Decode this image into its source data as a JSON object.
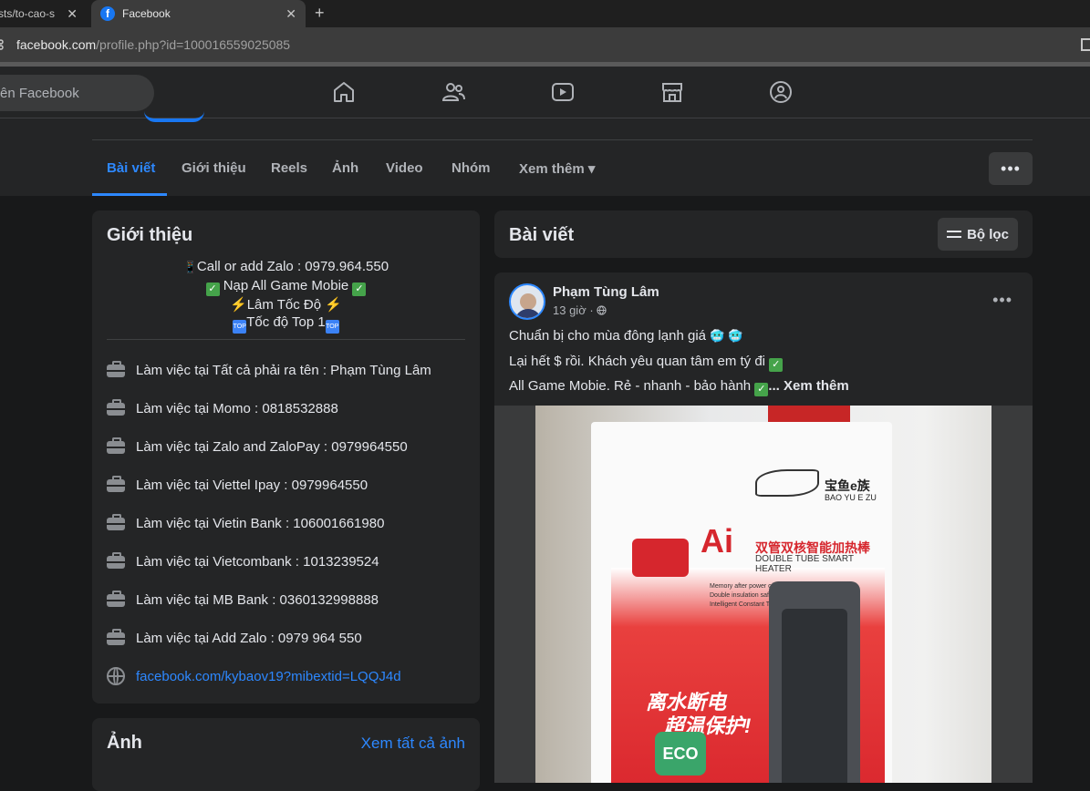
{
  "browser": {
    "tabs": [
      {
        "title": "sts/to-cao-s",
        "close": "✕"
      },
      {
        "title": "Facebook",
        "favicon": "f",
        "close": "✕"
      }
    ],
    "new_tab": "+",
    "url_host": "facebook.com",
    "url_path": "/profile.php?id=100016559025085"
  },
  "header": {
    "search_placeholder": "ên Facebook",
    "nav_icons": [
      "home-icon",
      "friends-icon",
      "watch-icon",
      "marketplace-icon",
      "groups-icon"
    ]
  },
  "profile_tabs": {
    "items": [
      "Bài viết",
      "Giới thiệu",
      "Reels",
      "Ảnh",
      "Video",
      "Nhóm",
      "Xem thêm ▾"
    ],
    "active": "Bài viết",
    "more": "•••"
  },
  "intro": {
    "title": "Giới thiệu",
    "bio_lines": [
      "Call or add Zalo : 0979.964.550",
      "Nạp All Game Mobie",
      "Lâm Tốc Độ",
      "Tốc độ Top 1"
    ],
    "bio_icons": {
      "phone": "📱",
      "check": "✓",
      "bolt": "⚡",
      "top": "TOP"
    },
    "work_items": [
      "Làm việc tại Tất cả phải ra tên : Phạm Tùng Lâm",
      "Làm việc tại Momo : 0818532888",
      "Làm việc tại Zalo and ZaloPay : 0979964550",
      "Làm việc tại Viettel Ipay : 0979964550",
      "Làm việc tại Vietin Bank : 106001661980",
      "Làm việc tại Vietcombank : 1013239524",
      "Làm việc tại MB Bank : 0360132998888",
      "Làm việc tại Add Zalo : 0979 964 550"
    ],
    "link": "facebook.com/kybaov19?mibextid=LQQJ4d"
  },
  "photos": {
    "title": "Ảnh",
    "see_all": "Xem tất cả ảnh"
  },
  "posts": {
    "title": "Bài viết",
    "filter_label": "Bộ lọc"
  },
  "post": {
    "author": "Phạm Tùng Lâm",
    "time": "13 giờ ·",
    "line1": "Chuẩn bị cho mùa đông lạnh giá",
    "line1_emoji": "🥶 🥶",
    "line2": "Lại hết $ rồi. Khách yêu quan tâm em tý đi",
    "line3": "All Game Mobie. Rẻ - nhanh - bảo hành",
    "see_more": "... Xem thêm",
    "check": "✓",
    "product": {
      "brand_cn": "宝鱼e族",
      "brand_en": "BAO YU E ZU",
      "ai": "Ai",
      "title_cn": "双管双核智能加热棒",
      "title_en": "DOUBLE TUBE SMART HEATER",
      "features": [
        "Memory after power off.",
        "Double insulation safety design",
        "Intelligent Constant Temperature"
      ],
      "slogan1": "离水断电",
      "slogan2": "超温保护!",
      "eco": "ECO"
    }
  }
}
